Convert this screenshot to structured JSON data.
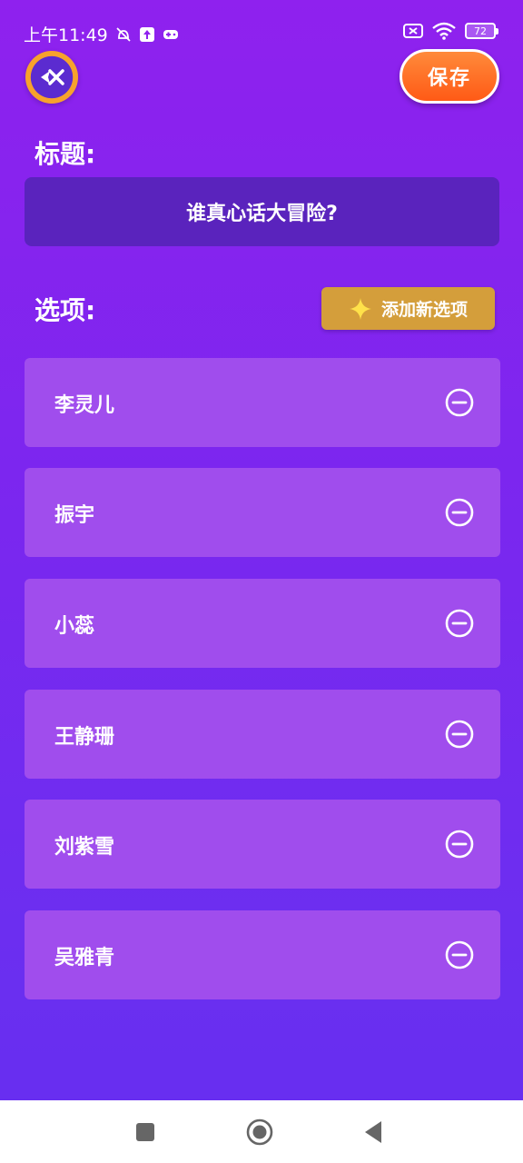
{
  "status_bar": {
    "time": "上午11:49",
    "battery": "72",
    "icons": [
      "alarm-off-icon",
      "upload-icon",
      "gamepad-icon",
      "sim-off-icon",
      "wifi-icon",
      "battery-icon"
    ]
  },
  "header": {
    "back_icon": "back-icon",
    "save_label": "保存"
  },
  "title_section": {
    "label": "标题:",
    "value": "谁真心话大冒险?"
  },
  "options_section": {
    "label": "选项:",
    "add_button_label": "添加新选项",
    "add_icon": "sparkle-icon",
    "items": [
      {
        "label": "李灵儿"
      },
      {
        "label": "振宇"
      },
      {
        "label": "小蕊"
      },
      {
        "label": "王静珊"
      },
      {
        "label": "刘紫雪"
      },
      {
        "label": "吴雅青"
      }
    ]
  },
  "nav_bar": {
    "recent": "recent-apps-icon",
    "home": "home-icon",
    "back": "nav-back-icon"
  },
  "colors": {
    "accent_save": "#ff5a16",
    "add_button": "#d49e3b",
    "card": "#a04ded",
    "title_box": "#5a23bd"
  }
}
